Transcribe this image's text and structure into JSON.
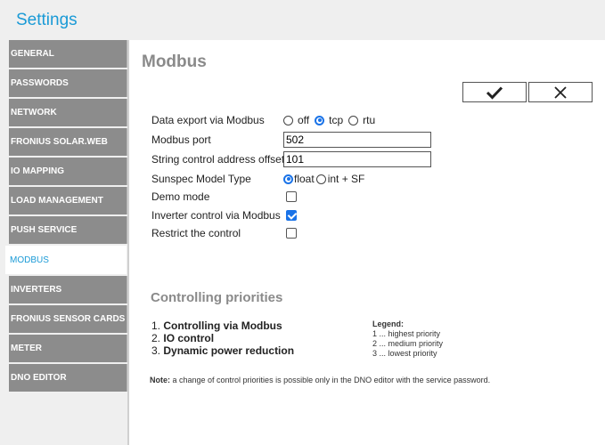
{
  "app": {
    "title": "Settings"
  },
  "nav": {
    "items": [
      {
        "label": "GENERAL"
      },
      {
        "label": "PASSWORDS"
      },
      {
        "label": "NETWORK"
      },
      {
        "label": "FRONIUS SOLAR.WEB"
      },
      {
        "label": "IO MAPPING"
      },
      {
        "label": "LOAD MANAGEMENT"
      },
      {
        "label": "PUSH SERVICE"
      },
      {
        "label": "MODBUS",
        "active": true
      },
      {
        "label": "INVERTERS"
      },
      {
        "label": "FRONIUS SENSOR CARDS"
      },
      {
        "label": "METER"
      },
      {
        "label": "DNO EDITOR"
      }
    ]
  },
  "page": {
    "title": "Modbus",
    "confirm_icon": "checkmark-icon",
    "cancel_icon": "close-icon"
  },
  "form": {
    "data_export": {
      "label": "Data export via Modbus",
      "options": [
        "off",
        "tcp",
        "rtu"
      ],
      "selected": "tcp"
    },
    "modbus_port": {
      "label": "Modbus port",
      "value": "502"
    },
    "string_offset": {
      "label": "String control address offset",
      "value": "101"
    },
    "sunspec_model": {
      "label": "Sunspec Model Type",
      "options": [
        "float",
        "int + SF"
      ],
      "selected": "float"
    },
    "demo_mode": {
      "label": "Demo mode",
      "checked": false
    },
    "inverter_control": {
      "label": "Inverter control via Modbus",
      "checked": true
    },
    "restrict_control": {
      "label": "Restrict the control",
      "checked": false
    }
  },
  "priorities": {
    "title": "Controlling priorities",
    "items": [
      {
        "num": "1.",
        "label": "Controlling via Modbus"
      },
      {
        "num": "2.",
        "label": "IO control"
      },
      {
        "num": "3.",
        "label": "Dynamic power reduction"
      }
    ],
    "legend": {
      "title": "Legend:",
      "lines": [
        "1 ... highest priority",
        "2 ... medium priority",
        "3 ... lowest priority"
      ]
    }
  },
  "note": {
    "prefix": "Note:",
    "text": " a change of control priorities is possible only in the DNO editor with the service password."
  },
  "colors": {
    "accent": "#1a9ad6",
    "nav_bg": "#8c8c8c",
    "title_gray": "#8a8a8a",
    "check_blue": "#1a73e8"
  }
}
